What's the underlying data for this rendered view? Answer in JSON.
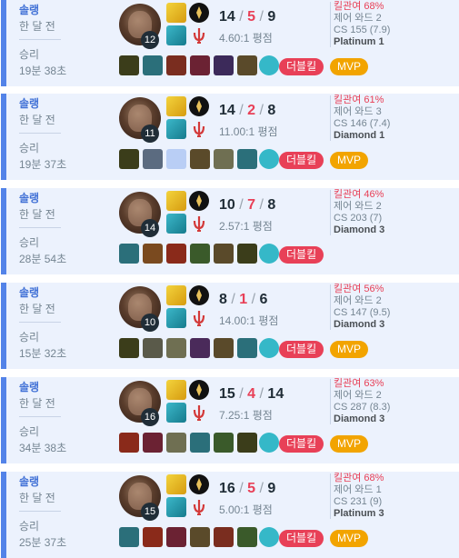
{
  "matches": [
    {
      "queue": "솔랭",
      "ago": "한 달 전",
      "result": "승리",
      "duration": "19분 38초",
      "level": "12",
      "kda": {
        "kills": "14",
        "deaths": "5",
        "assists": "9",
        "slash": "/"
      },
      "ratio": "4.60:1 평점",
      "kill_participation": "킬관여 68%",
      "control_wards": "제어 와드 2",
      "cs": "CS 155 (7.9)",
      "tier": "Platinum 1",
      "badges": [
        "더블킬",
        "MVP"
      ],
      "items": [
        "#3b3d1a",
        "#2b6f7a",
        "#7a2d1f",
        "#6b2233",
        "#3c2a5a",
        "#5a4a2a",
        "#35b8c8"
      ]
    },
    {
      "queue": "솔랭",
      "ago": "한 달 전",
      "result": "승리",
      "duration": "19분 37초",
      "level": "11",
      "kda": {
        "kills": "14",
        "deaths": "2",
        "assists": "8",
        "slash": "/"
      },
      "ratio": "11.00:1 평점",
      "kill_participation": "킬관여 61%",
      "control_wards": "제어 와드 3",
      "cs": "CS 146 (7.4)",
      "tier": "Diamond 1",
      "badges": [
        "더블킬",
        "MVP"
      ],
      "items": [
        "#3b3d1a",
        "#5b6b80",
        "#b9cef5",
        "#5a4a2a",
        "#6f6f52",
        "#2b6f7a",
        "#35b8c8"
      ]
    },
    {
      "queue": "솔랭",
      "ago": "한 달 전",
      "result": "승리",
      "duration": "28분 54초",
      "level": "14",
      "kda": {
        "kills": "10",
        "deaths": "7",
        "assists": "8",
        "slash": "/"
      },
      "ratio": "2.57:1 평점",
      "kill_participation": "킬관여 46%",
      "control_wards": "제어 와드 2",
      "cs": "CS 203 (7)",
      "tier": "Diamond 3",
      "badges": [
        "더블킬"
      ],
      "items": [
        "#2b6f7a",
        "#7a4a1f",
        "#8a2a1a",
        "#3a5a2a",
        "#5a4a2a",
        "#3b3d1a",
        "#35b8c8"
      ]
    },
    {
      "queue": "솔랭",
      "ago": "한 달 전",
      "result": "승리",
      "duration": "15분 32초",
      "level": "10",
      "kda": {
        "kills": "8",
        "deaths": "1",
        "assists": "6",
        "slash": "/"
      },
      "ratio": "14.00:1 평점",
      "kill_participation": "킬관여 56%",
      "control_wards": "제어 와드 2",
      "cs": "CS 147 (9.5)",
      "tier": "Diamond 3",
      "badges": [
        "더블킬",
        "MVP"
      ],
      "items": [
        "#3b3d1a",
        "#5a5a4a",
        "#6f6f52",
        "#4a2a5a",
        "#5a4a2a",
        "#2b6f7a",
        "#35b8c8"
      ]
    },
    {
      "queue": "솔랭",
      "ago": "한 달 전",
      "result": "승리",
      "duration": "34분 38초",
      "level": "16",
      "kda": {
        "kills": "15",
        "deaths": "4",
        "assists": "14",
        "slash": "/"
      },
      "ratio": "7.25:1 평점",
      "kill_participation": "킬관여 63%",
      "control_wards": "제어 와드 2",
      "cs": "CS 287 (8.3)",
      "tier": "Diamond 3",
      "badges": [
        "더블킬",
        "MVP"
      ],
      "items": [
        "#8a2a1a",
        "#6b2233",
        "#6f6f52",
        "#2b6f7a",
        "#3a5a2a",
        "#3b3d1a",
        "#35b8c8"
      ]
    },
    {
      "queue": "솔랭",
      "ago": "한 달 전",
      "result": "승리",
      "duration": "25분 37초",
      "level": "15",
      "kda": {
        "kills": "16",
        "deaths": "5",
        "assists": "9",
        "slash": "/"
      },
      "ratio": "5.00:1 평점",
      "kill_participation": "킬관여 68%",
      "control_wards": "제어 와드 1",
      "cs": "CS 231 (9)",
      "tier": "Platinum 3",
      "badges": [
        "더블킬",
        "MVP"
      ],
      "items": [
        "#2b6f7a",
        "#8a2a1a",
        "#6b2233",
        "#5a4a2a",
        "#7a2d1f",
        "#3a5a2a",
        "#35b8c8"
      ]
    }
  ],
  "icons": {
    "spell1": "flash-icon",
    "spell2": "ghost-icon",
    "rune1": "keystone-rune-icon",
    "rune2": "secondary-rune-icon",
    "champion": "champion-portrait-icon"
  },
  "colors": {
    "accent": "#5383e8",
    "death": "#e84057",
    "mvp": "#f2a400",
    "card_bg": "#ecf2fd"
  }
}
